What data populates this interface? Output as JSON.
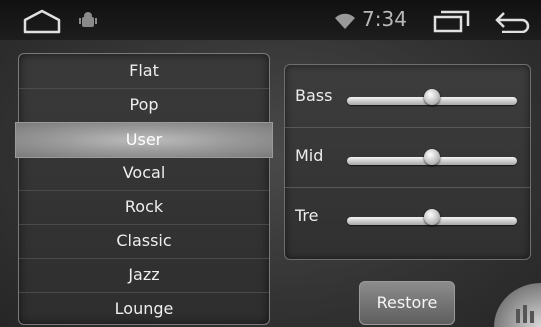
{
  "status_bar": {
    "time": "7:34",
    "icons": [
      "home-icon",
      "android-icon",
      "wifi-icon",
      "recent-apps-icon",
      "back-icon"
    ]
  },
  "presets": {
    "items": [
      "Flat",
      "Pop",
      "User",
      "Vocal",
      "Rock",
      "Classic",
      "Jazz",
      "Lounge"
    ],
    "selected": "User"
  },
  "equalizer": {
    "bands": [
      {
        "label": "Bass",
        "level": 0.5
      },
      {
        "label": "Mid",
        "level": 0.5
      },
      {
        "label": "Tre",
        "level": 0.5
      }
    ]
  },
  "actions": {
    "restore_label": "Restore"
  },
  "colors": {
    "background": "#2b2b2b",
    "status_bar": "#1a1a1a",
    "selected_item": "#a8a8a8",
    "slider_track": "#d0d0d0"
  }
}
